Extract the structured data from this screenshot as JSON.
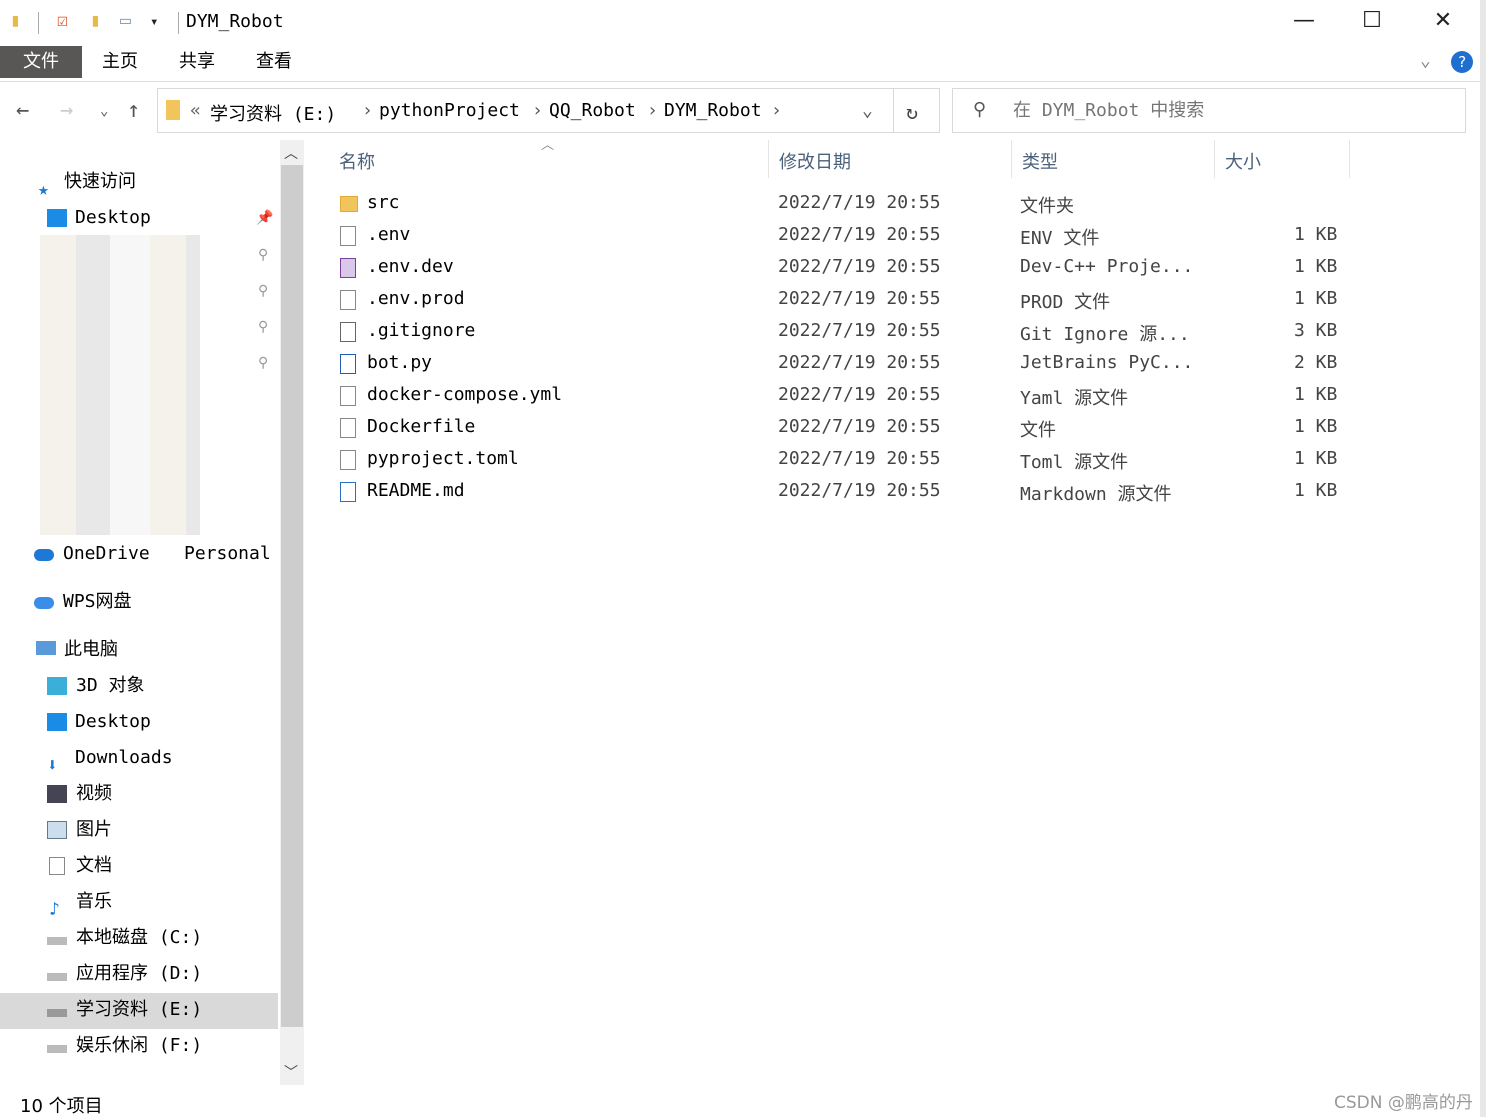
{
  "window": {
    "title": "DYM_Robot",
    "minimize_icon": "minimize-icon",
    "maximize_icon": "maximize-icon",
    "close_icon": "close-icon"
  },
  "ribbon": {
    "tabs": [
      "文件",
      "主页",
      "共享",
      "查看"
    ],
    "help": "?"
  },
  "address": {
    "prefix": "«",
    "crumbs": [
      "学习资料 (E:)",
      "pythonProject",
      "QQ_Robot",
      "DYM_Robot"
    ]
  },
  "search": {
    "placeholder": "在 DYM_Robot 中搜索"
  },
  "sidebar": {
    "quick_access": "快速访问",
    "quick_items": [
      "Desktop"
    ],
    "onedrive": "OneDrive",
    "onedrive_suffix": "Personal",
    "wps": "WPS网盘",
    "this_pc": "此电脑",
    "pc_items": [
      "3D 对象",
      "Desktop",
      "Downloads",
      "视频",
      "图片",
      "文档",
      "音乐",
      "本地磁盘 (C:)",
      "应用程序 (D:)",
      "学习资料 (E:)",
      "娱乐休闲 (F:)"
    ],
    "selected": "学习资料 (E:)"
  },
  "columns": [
    "名称",
    "修改日期",
    "类型",
    "大小"
  ],
  "files": [
    {
      "name": "src",
      "date": "2022/7/19 20:55",
      "type": "文件夹",
      "size": "",
      "icon": "folder"
    },
    {
      "name": ".env",
      "date": "2022/7/19 20:55",
      "type": "ENV 文件",
      "size": "1 KB",
      "icon": "file"
    },
    {
      "name": ".env.dev",
      "date": "2022/7/19 20:55",
      "type": "Dev-C++ Proje...",
      "size": "1 KB",
      "icon": "devcpp"
    },
    {
      "name": ".env.prod",
      "date": "2022/7/19 20:55",
      "type": "PROD 文件",
      "size": "1 KB",
      "icon": "file"
    },
    {
      "name": ".gitignore",
      "date": "2022/7/19 20:55",
      "type": "Git Ignore 源...",
      "size": "3 KB",
      "icon": "gear-file"
    },
    {
      "name": "bot.py",
      "date": "2022/7/19 20:55",
      "type": "JetBrains PyC...",
      "size": "2 KB",
      "icon": "python-file"
    },
    {
      "name": "docker-compose.yml",
      "date": "2022/7/19 20:55",
      "type": "Yaml 源文件",
      "size": "1 KB",
      "icon": "yaml-file"
    },
    {
      "name": "Dockerfile",
      "date": "2022/7/19 20:55",
      "type": "文件",
      "size": "1 KB",
      "icon": "file"
    },
    {
      "name": "pyproject.toml",
      "date": "2022/7/19 20:55",
      "type": "Toml 源文件",
      "size": "1 KB",
      "icon": "text-file"
    },
    {
      "name": "README.md",
      "date": "2022/7/19 20:55",
      "type": "Markdown 源文件",
      "size": "1 KB",
      "icon": "markdown-file"
    }
  ],
  "status": {
    "count": "10 个项目"
  },
  "watermark": "CSDN @鹏高的丹",
  "colors": {
    "file_tab": "#585755",
    "selected": "#d9d9d9",
    "header_text": "#4c607a"
  }
}
